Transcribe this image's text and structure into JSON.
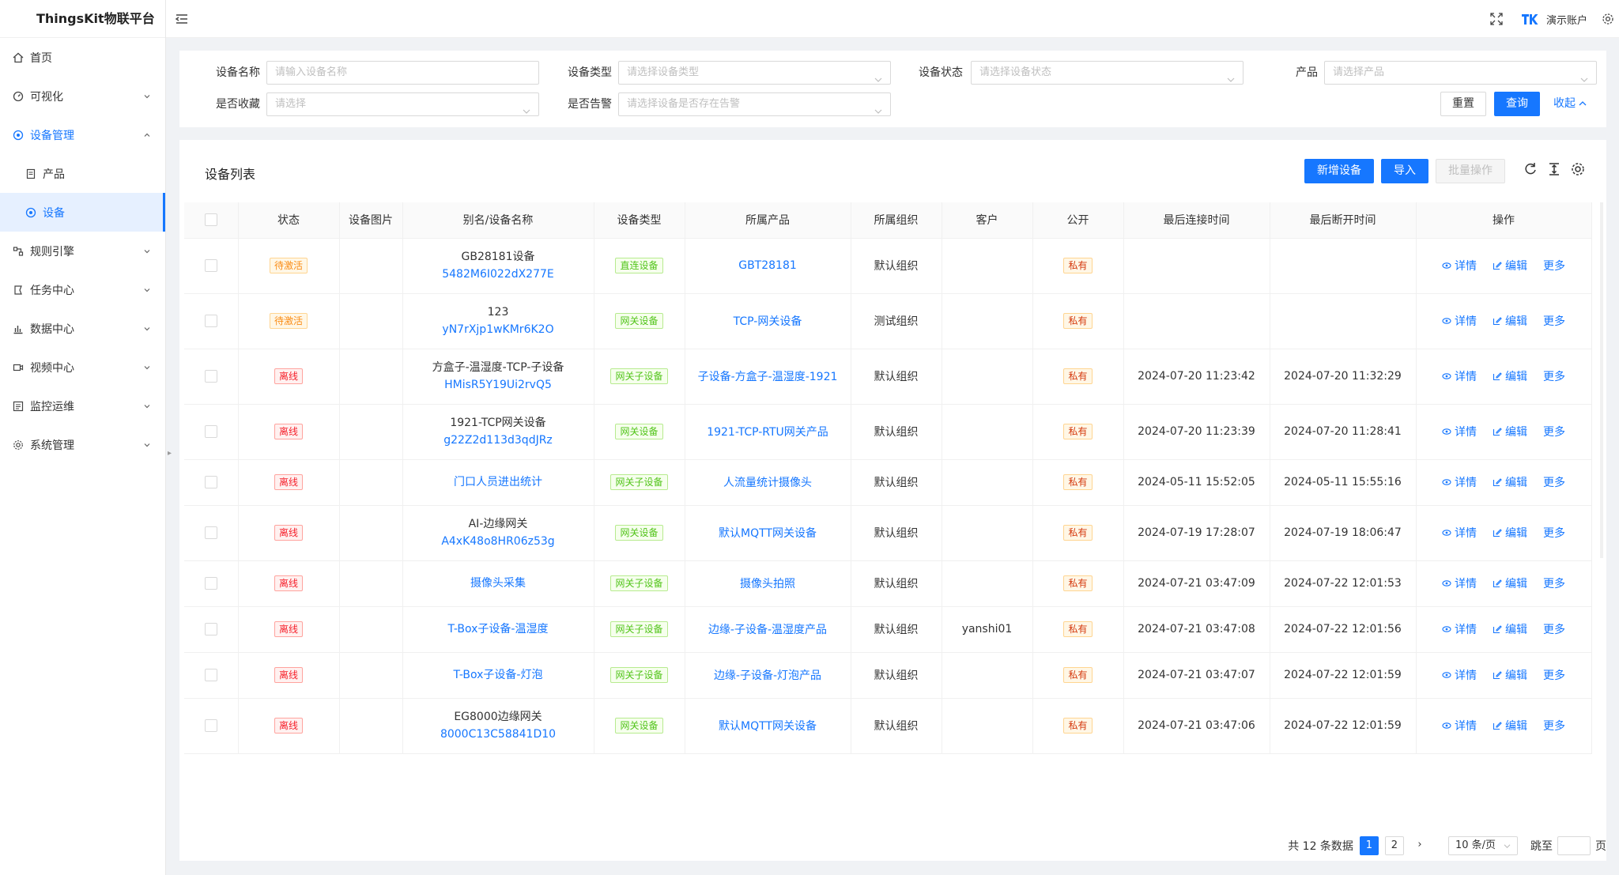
{
  "app": {
    "title": "ThingsKit物联平台"
  },
  "header": {
    "username": "演示账户"
  },
  "sidebar": {
    "items": [
      {
        "label": "首页",
        "icon": "home-icon"
      },
      {
        "label": "可视化",
        "icon": "dashboard-icon"
      },
      {
        "label": "设备管理",
        "icon": "device-icon"
      },
      {
        "label": "产品",
        "icon": "product-icon"
      },
      {
        "label": "设备",
        "icon": "device-icon"
      },
      {
        "label": "规则引擎",
        "icon": "rule-icon"
      },
      {
        "label": "任务中心",
        "icon": "task-icon"
      },
      {
        "label": "数据中心",
        "icon": "chart-icon"
      },
      {
        "label": "视频中心",
        "icon": "video-icon"
      },
      {
        "label": "监控运维",
        "icon": "monitor-icon"
      },
      {
        "label": "系统管理",
        "icon": "gear-icon"
      }
    ]
  },
  "filter": {
    "device_name_label": "设备名称",
    "device_name_placeholder": "请输入设备名称",
    "device_type_label": "设备类型",
    "device_type_placeholder": "请选择设备类型",
    "device_status_label": "设备状态",
    "device_status_placeholder": "请选择设备状态",
    "product_label": "产品",
    "product_placeholder": "请选择产品",
    "favorite_label": "是否收藏",
    "favorite_placeholder": "请选择",
    "alarm_label": "是否告警",
    "alarm_placeholder": "请选择设备是否存在告警",
    "reset": "重置",
    "query": "查询",
    "collapse": "收起"
  },
  "panel": {
    "title": "设备列表",
    "add_device": "新增设备",
    "import": "导入",
    "batch": "批量操作"
  },
  "table": {
    "headers": [
      "状态",
      "设备图片",
      "别名/设备名称",
      "设备类型",
      "所属产品",
      "所属组织",
      "客户",
      "公开",
      "最后连接时间",
      "最后断开时间",
      "操作"
    ],
    "actions": {
      "detail": "详情",
      "edit": "编辑",
      "more": "更多"
    },
    "rows": [
      {
        "status": "待激活",
        "status_color": "orange",
        "name": "GB28181设备",
        "sub": "5482M6I022dX277E",
        "type": "直连设备",
        "product": "GBT28181",
        "org": "默认组织",
        "customer": "",
        "public": "私有",
        "last_conn": "",
        "last_disc": ""
      },
      {
        "status": "待激活",
        "status_color": "orange",
        "name": "123",
        "sub": "yN7rXjp1wKMr6K2O",
        "type": "网关设备",
        "product": "TCP-网关设备",
        "org": "测试组织",
        "customer": "",
        "public": "私有",
        "last_conn": "",
        "last_disc": ""
      },
      {
        "status": "离线",
        "status_color": "red",
        "name": "方盒子-温湿度-TCP-子设备",
        "sub": "HMisR5Y19Ui2rvQ5",
        "type": "网关子设备",
        "product": "子设备-方盒子-温湿度-1921",
        "org": "默认组织",
        "customer": "",
        "public": "私有",
        "last_conn": "2024-07-20 11:23:42",
        "last_disc": "2024-07-20 11:32:29"
      },
      {
        "status": "离线",
        "status_color": "red",
        "name": "1921-TCP网关设备",
        "sub": "g22Z2d113d3qdJRz",
        "type": "网关设备",
        "product": "1921-TCP-RTU网关产品",
        "org": "默认组织",
        "customer": "",
        "public": "私有",
        "last_conn": "2024-07-20 11:23:39",
        "last_disc": "2024-07-20 11:28:41"
      },
      {
        "status": "离线",
        "status_color": "red",
        "name": "",
        "sub": "门口人员进出统计",
        "type": "网关子设备",
        "product": "人流量统计摄像头",
        "org": "默认组织",
        "customer": "",
        "public": "私有",
        "last_conn": "2024-05-11 15:52:05",
        "last_disc": "2024-05-11 15:55:16"
      },
      {
        "status": "离线",
        "status_color": "red",
        "name": "AI-边缘网关",
        "sub": "A4xK48o8HR06z53g",
        "type": "网关设备",
        "product": "默认MQTT网关设备",
        "org": "默认组织",
        "customer": "",
        "public": "私有",
        "last_conn": "2024-07-19 17:28:07",
        "last_disc": "2024-07-19 18:06:47"
      },
      {
        "status": "离线",
        "status_color": "red",
        "name": "",
        "sub": "摄像头采集",
        "type": "网关子设备",
        "product": "摄像头拍照",
        "org": "默认组织",
        "customer": "",
        "public": "私有",
        "last_conn": "2024-07-21 03:47:09",
        "last_disc": "2024-07-22 12:01:53"
      },
      {
        "status": "离线",
        "status_color": "red",
        "name": "",
        "sub": "T-Box子设备-温湿度",
        "type": "网关子设备",
        "product": "边缘-子设备-温湿度产品",
        "org": "默认组织",
        "customer": "yanshi01",
        "public": "私有",
        "last_conn": "2024-07-21 03:47:08",
        "last_disc": "2024-07-22 12:01:56"
      },
      {
        "status": "离线",
        "status_color": "red",
        "name": "",
        "sub": "T-Box子设备-灯泡",
        "type": "网关子设备",
        "product": "边缘-子设备-灯泡产品",
        "org": "默认组织",
        "customer": "",
        "public": "私有",
        "last_conn": "2024-07-21 03:47:07",
        "last_disc": "2024-07-22 12:01:59"
      },
      {
        "status": "离线",
        "status_color": "red",
        "name": "EG8000边缘网关",
        "sub": "8000C13C58841D10",
        "type": "网关设备",
        "product": "默认MQTT网关设备",
        "org": "默认组织",
        "customer": "",
        "public": "私有",
        "last_conn": "2024-07-21 03:47:06",
        "last_disc": "2024-07-22 12:01:59"
      }
    ]
  },
  "pagination": {
    "total_text": "共 12 条数据",
    "pages": [
      "1",
      "2"
    ],
    "current": "1",
    "page_size": "10 条/页",
    "jump_label": "跳至",
    "page_suffix": "页"
  },
  "colors": {
    "primary": "#1677ff",
    "sidebar_active_bg": "#e6f0ff"
  }
}
